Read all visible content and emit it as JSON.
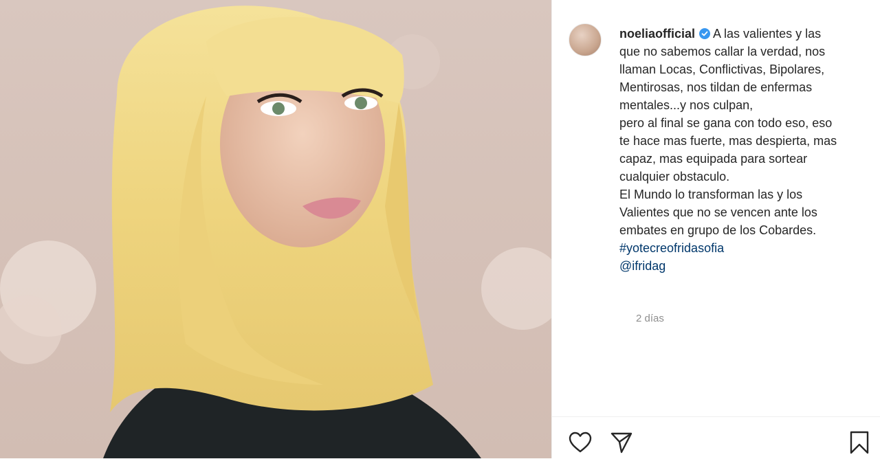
{
  "post": {
    "author": {
      "username": "noeliaofficial",
      "verified": true
    },
    "caption_lines": [
      "A las valientes y las",
      "que no sabemos callar la verdad, nos",
      "llaman Locas, Conflictivas, Bipolares,",
      "Mentirosas, nos tildan de enfermas",
      "mentales...y nos culpan,",
      "pero al final se gana con todo eso, eso",
      "te hace mas fuerte, mas despierta, mas",
      "capaz, mas equipada para sortear",
      "cualquier obstaculo.",
      "El Mundo lo transforman las y los",
      "Valientes que no se vencen ante los",
      "embates en grupo de los Cobardes."
    ],
    "hashtag": "#yotecreofridasofia",
    "mention": "@ifridag",
    "timestamp": "2 días"
  },
  "colors": {
    "link": "#00376b",
    "text": "#262626",
    "muted": "#8e8e8e",
    "verified_badge": "#3897f0"
  },
  "icons": {
    "like": "heart-icon",
    "share": "paper-plane-icon",
    "save": "bookmark-icon",
    "verified": "verified-badge-icon"
  }
}
